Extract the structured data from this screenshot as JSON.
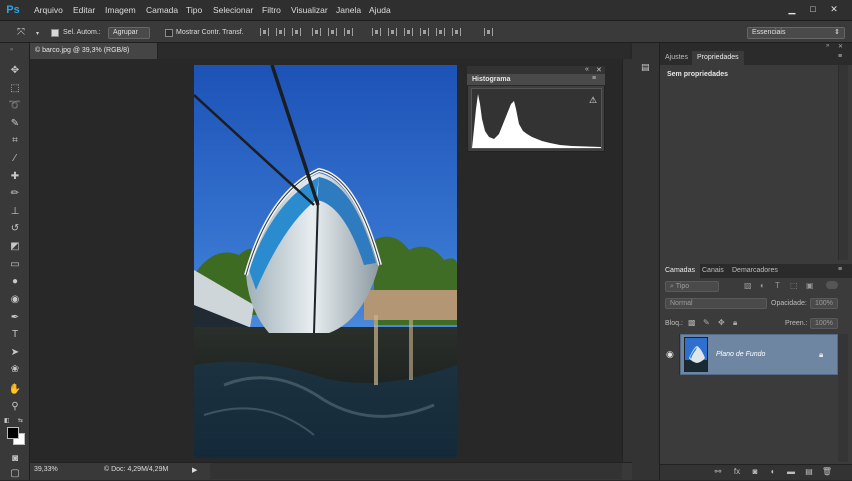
{
  "app": {
    "logo": "Ps"
  },
  "menu": [
    "Arquivo",
    "Editar",
    "Imagem",
    "Camada",
    "Tipo",
    "Selecionar",
    "Filtro",
    "Visualizar",
    "Janela",
    "Ajuda"
  ],
  "window_controls": {
    "minimize": "▁",
    "restore": "□",
    "close": "✕"
  },
  "options_bar": {
    "auto_select_label": "Sel. Autom.:",
    "group_select_value": "Agrupar",
    "show_transform_label": "Mostrar Contr. Transf.",
    "workspace_value": "Essenciais"
  },
  "document": {
    "tab_title": "© barco.jpg @ 39,3% (RGB/8)",
    "tab_close": "×"
  },
  "status_bar": {
    "zoom": "39,33%",
    "doc_size": "© Doc: 4,29M/4,29M",
    "arrow": "▶"
  },
  "histogram_panel": {
    "title": "Histograma",
    "warning_icon": "⚠",
    "collapse": "«",
    "close": "✕"
  },
  "properties_panel": {
    "tabs": [
      "Ajustes",
      "Propriedades"
    ],
    "active_tab": "Propriedades",
    "message": "Sem propriedades"
  },
  "layers_panel": {
    "tabs": [
      "Camadas",
      "Canais",
      "Demarcadores"
    ],
    "filter_value": "Tipo",
    "blend_mode": "Normal",
    "opacity_label": "Opacidade:",
    "opacity_value": "100%",
    "lock_label": "Bloq.:",
    "fill_label": "Preen.:",
    "fill_value": "100%",
    "layers": [
      {
        "name": "Plano de Fundo",
        "visible": true,
        "locked": true
      }
    ]
  },
  "colors": {
    "accent_logo": "#2fa3e8",
    "selected_layer": "#6f86a3",
    "sky": "#2f6fd0",
    "boat_blue": "#2a8ccf"
  }
}
